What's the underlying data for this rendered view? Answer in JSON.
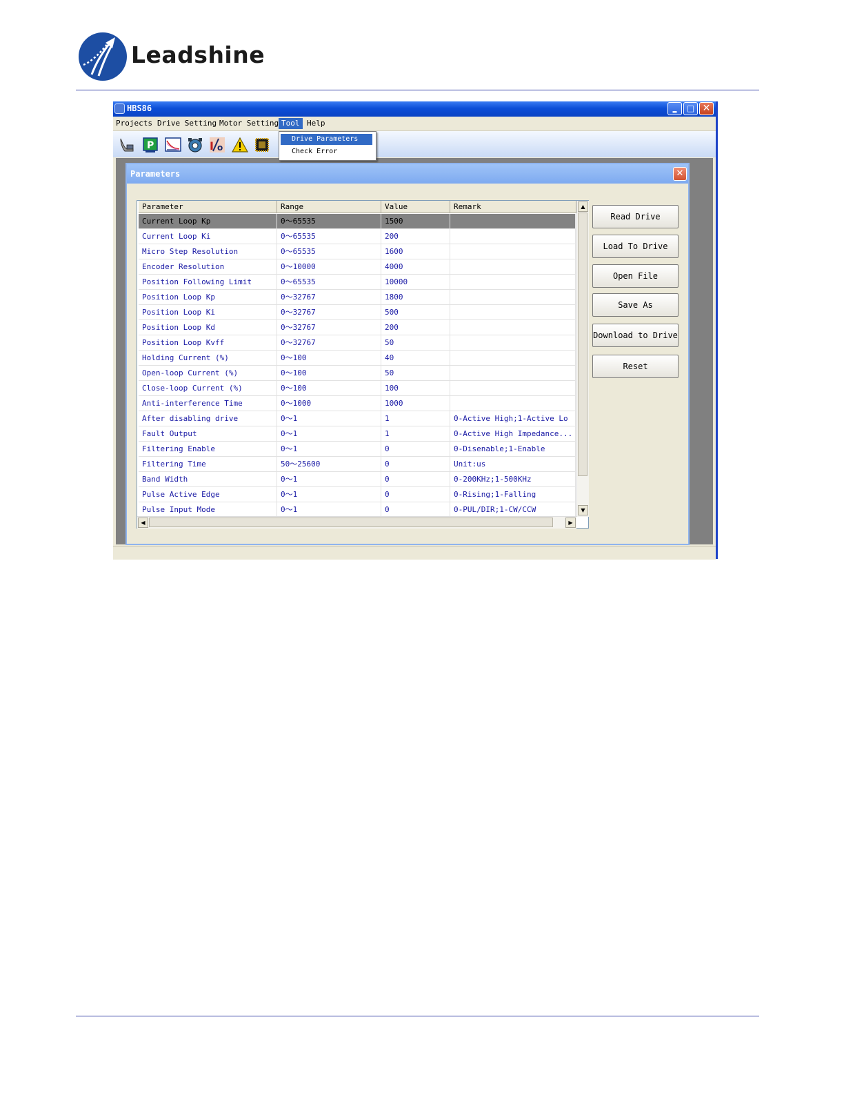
{
  "brand": {
    "name": "Leadshine",
    "logo_color": "#1d4ea3"
  },
  "window": {
    "title": "HBS86",
    "controls": {
      "minimize": "‗",
      "maximize": "□",
      "close": "✕"
    }
  },
  "menubar": [
    "Projects",
    "Drive Setting",
    "Motor Setting",
    "Tool",
    "Help"
  ],
  "dropdown": [
    "Drive Parameters",
    "Check Error"
  ],
  "toolbar_icons": [
    "wizard-icon",
    "parameter-icon",
    "scope-icon",
    "motor-icon",
    "io-icon",
    "warning-icon",
    "chip-icon"
  ],
  "dialog": {
    "title": "Parameters",
    "close": "✕",
    "columns": [
      "Parameter",
      "Range",
      "Value",
      "Remark"
    ],
    "rows": [
      [
        "Current Loop Kp",
        "0～65535",
        "1500",
        ""
      ],
      [
        "Current Loop Ki",
        "0～65535",
        "200",
        ""
      ],
      [
        "Micro Step Resolution",
        "0～65535",
        "1600",
        ""
      ],
      [
        "Encoder Resolution",
        "0～10000",
        "4000",
        ""
      ],
      [
        "Position Following Limit",
        "0～65535",
        "10000",
        ""
      ],
      [
        "Position Loop Kp",
        "0～32767",
        "1800",
        ""
      ],
      [
        "Position Loop Ki",
        "0～32767",
        "500",
        ""
      ],
      [
        "Position Loop Kd",
        "0～32767",
        "200",
        ""
      ],
      [
        "Position Loop Kvff",
        "0～32767",
        "50",
        ""
      ],
      [
        "Holding Current (%)",
        "0～100",
        "40",
        ""
      ],
      [
        "Open-loop Current (%)",
        "0～100",
        "50",
        ""
      ],
      [
        "Close-loop Current (%)",
        "0～100",
        "100",
        ""
      ],
      [
        "Anti-interference Time",
        "0～1000",
        "1000",
        ""
      ],
      [
        "After disabling drive",
        "0～1",
        "1",
        "0-Active High;1-Active Lo"
      ],
      [
        "Fault Output",
        "0～1",
        "1",
        "0-Active High Impedance..."
      ],
      [
        "Filtering Enable",
        "0～1",
        "0",
        "0-Disenable;1-Enable"
      ],
      [
        "Filtering Time",
        "50～25600",
        "0",
        "Unit:us"
      ],
      [
        "Band Width",
        "0～1",
        "0",
        "0-200KHz;1-500KHz"
      ],
      [
        "Pulse Active Edge",
        "0～1",
        "0",
        "0-Rising;1-Falling"
      ],
      [
        "Pulse Input Mode",
        "0～1",
        "0",
        "0-PUL/DIR;1-CW/CCW"
      ]
    ],
    "buttons": [
      "Read Drive",
      "Load To Drive",
      "Open File",
      "Save As",
      "Download to Drive",
      "Reset"
    ],
    "scroll": {
      "up": "▲",
      "down": "▼",
      "left": "◀",
      "right": "▶"
    }
  },
  "colors": {
    "titlebar": "#0d4fd8",
    "selection": "#316ac5",
    "grid_text": "#1a1aa5",
    "selected_row": "#838383"
  }
}
